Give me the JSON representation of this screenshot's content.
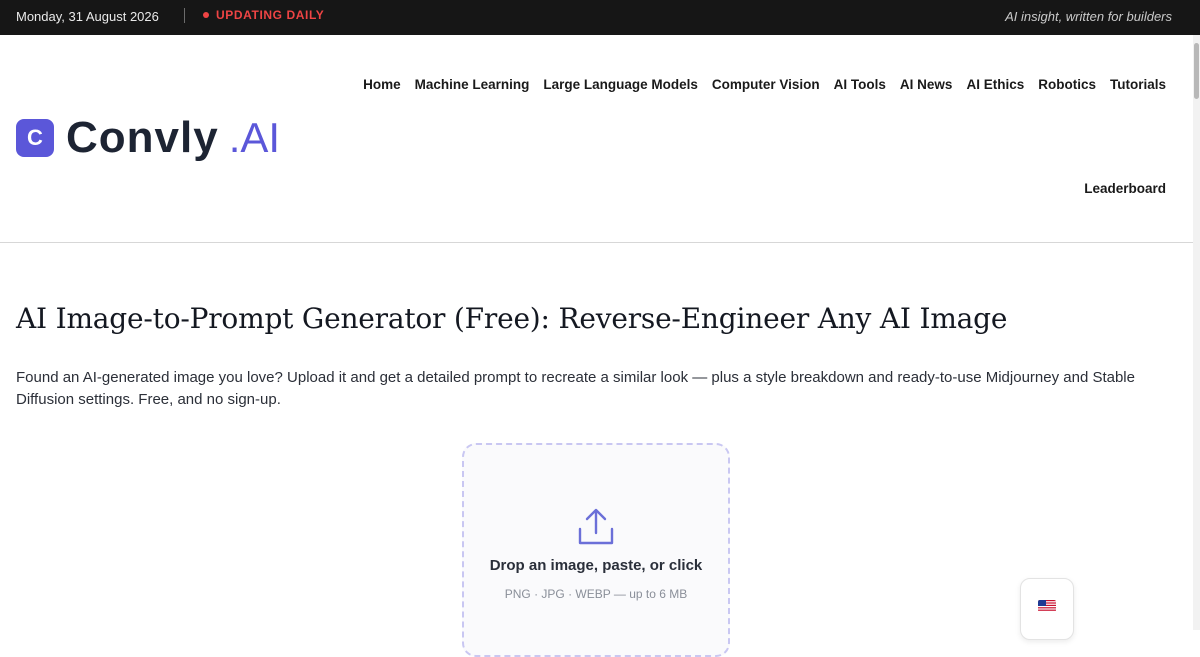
{
  "topbar": {
    "date": "Monday, 31 August 2026",
    "live_label": "UPDATING DAILY",
    "tagline": "AI insight, written for builders"
  },
  "logo": {
    "badge_letter": "C",
    "name": "Convly",
    "suffix": ".AI",
    "brand_color": "#5b57d9"
  },
  "nav": {
    "items": [
      "Home",
      "Machine Learning",
      "Large Language Models",
      "Computer Vision",
      "AI Tools",
      "AI News",
      "AI Ethics",
      "Robotics",
      "Tutorials"
    ],
    "second_row": "Leaderboard"
  },
  "main": {
    "title": "AI Image-to-Prompt Generator (Free): Reverse-Engineer Any AI Image",
    "description": "Found an AI-generated image you love? Upload it and get a detailed prompt to recreate a similar look — plus a style breakdown and ready-to-use Midjourney and Stable Diffusion settings. Free, and no sign-up."
  },
  "dropzone": {
    "icon": "upload-icon",
    "title": "Drop an image, paste, or click",
    "subtitle": "PNG · JPG · WEBP — up to 6 MB"
  },
  "language": {
    "icon": "us-flag-icon"
  }
}
